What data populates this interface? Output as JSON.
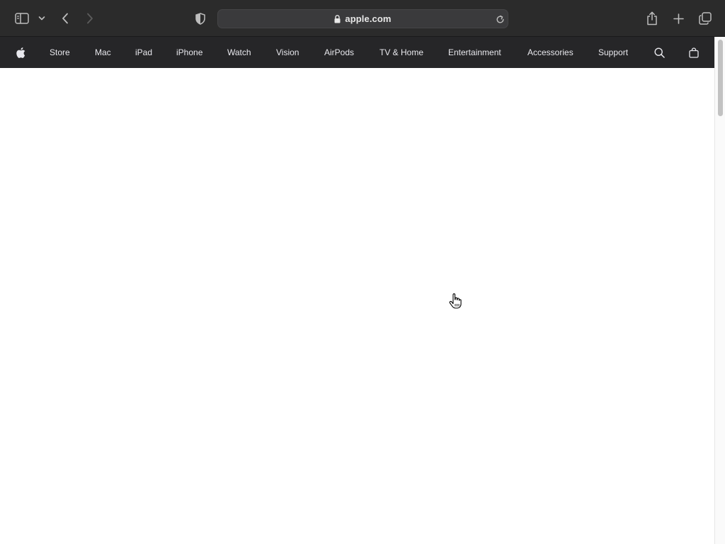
{
  "browser": {
    "address": "apple.com",
    "icons": {
      "sidebar": "sidebar-icon",
      "tab_group": "chevron-down-icon",
      "back": "chevron-left-icon",
      "forward": "chevron-right-icon",
      "privacy": "shield-icon",
      "lock": "lock-icon",
      "reload": "reload-icon",
      "share": "share-icon",
      "new_tab": "plus-icon",
      "tab_overview": "tabs-overview-icon"
    }
  },
  "globalnav": {
    "items": [
      {
        "label": "Store"
      },
      {
        "label": "Mac"
      },
      {
        "label": "iPad"
      },
      {
        "label": "iPhone"
      },
      {
        "label": "Watch"
      },
      {
        "label": "Vision"
      },
      {
        "label": "AirPods"
      },
      {
        "label": "TV & Home"
      },
      {
        "label": "Entertainment"
      },
      {
        "label": "Accessories"
      },
      {
        "label": "Support"
      }
    ],
    "icons": {
      "logo": "apple-logo-icon",
      "search": "search-icon",
      "bag": "shopping-bag-icon"
    }
  },
  "colors": {
    "toolbar_bg": "#2b2b2b",
    "nav_bg": "#262628",
    "nav_text": "#e8e8ed",
    "page_bg": "#ffffff"
  }
}
